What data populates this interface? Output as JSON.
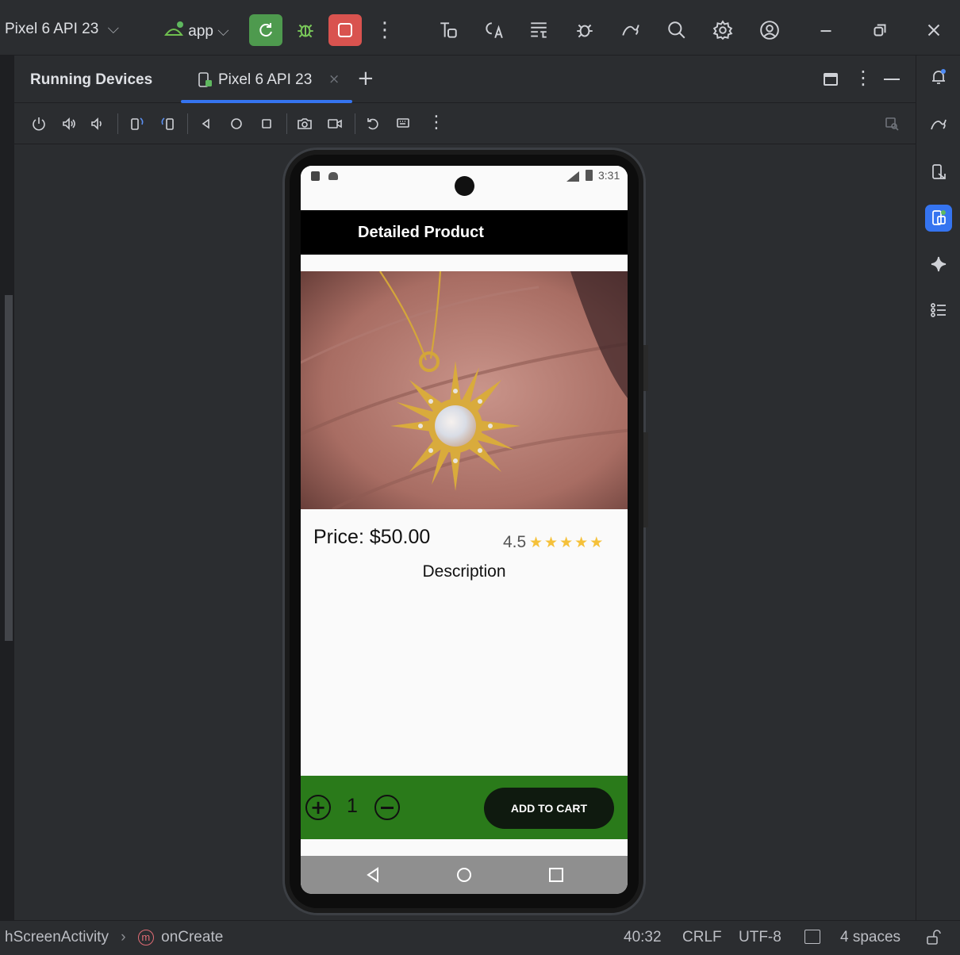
{
  "toolbar": {
    "device_selector": "Pixel 6 API 23",
    "run_config": "app",
    "icons": [
      "rerun-icon",
      "debug-icon",
      "stop-icon",
      "more-icon",
      "profiler-icon",
      "translate-icon",
      "layout-icon",
      "bug-icon",
      "gemini-icon",
      "search-icon",
      "settings-icon",
      "account-icon",
      "minimize-icon",
      "restore-icon",
      "close-icon"
    ],
    "colors": {
      "rerun": "#4e9a4e",
      "stop": "#d9534f"
    }
  },
  "panel": {
    "title": "Running Devices",
    "tab_label": "Pixel 6 API 23",
    "accent": "#3574f0"
  },
  "phone": {
    "status_time": "3:31",
    "app_title": "Detailed Product",
    "price": "Price: $50.00",
    "rating": "4.5",
    "stars": 5,
    "description_heading": "Description",
    "quantity": "1",
    "add_to_cart": "ADD TO CART",
    "bottom_bar_color": "#2a7a1a",
    "star_color": "#f5c13a"
  },
  "statusline": {
    "breadcrumb_class": "hScreenActivity",
    "breadcrumb_method": "onCreate",
    "position": "40:32",
    "line_sep": "CRLF",
    "encoding": "UTF-8",
    "indent": "4 spaces"
  }
}
